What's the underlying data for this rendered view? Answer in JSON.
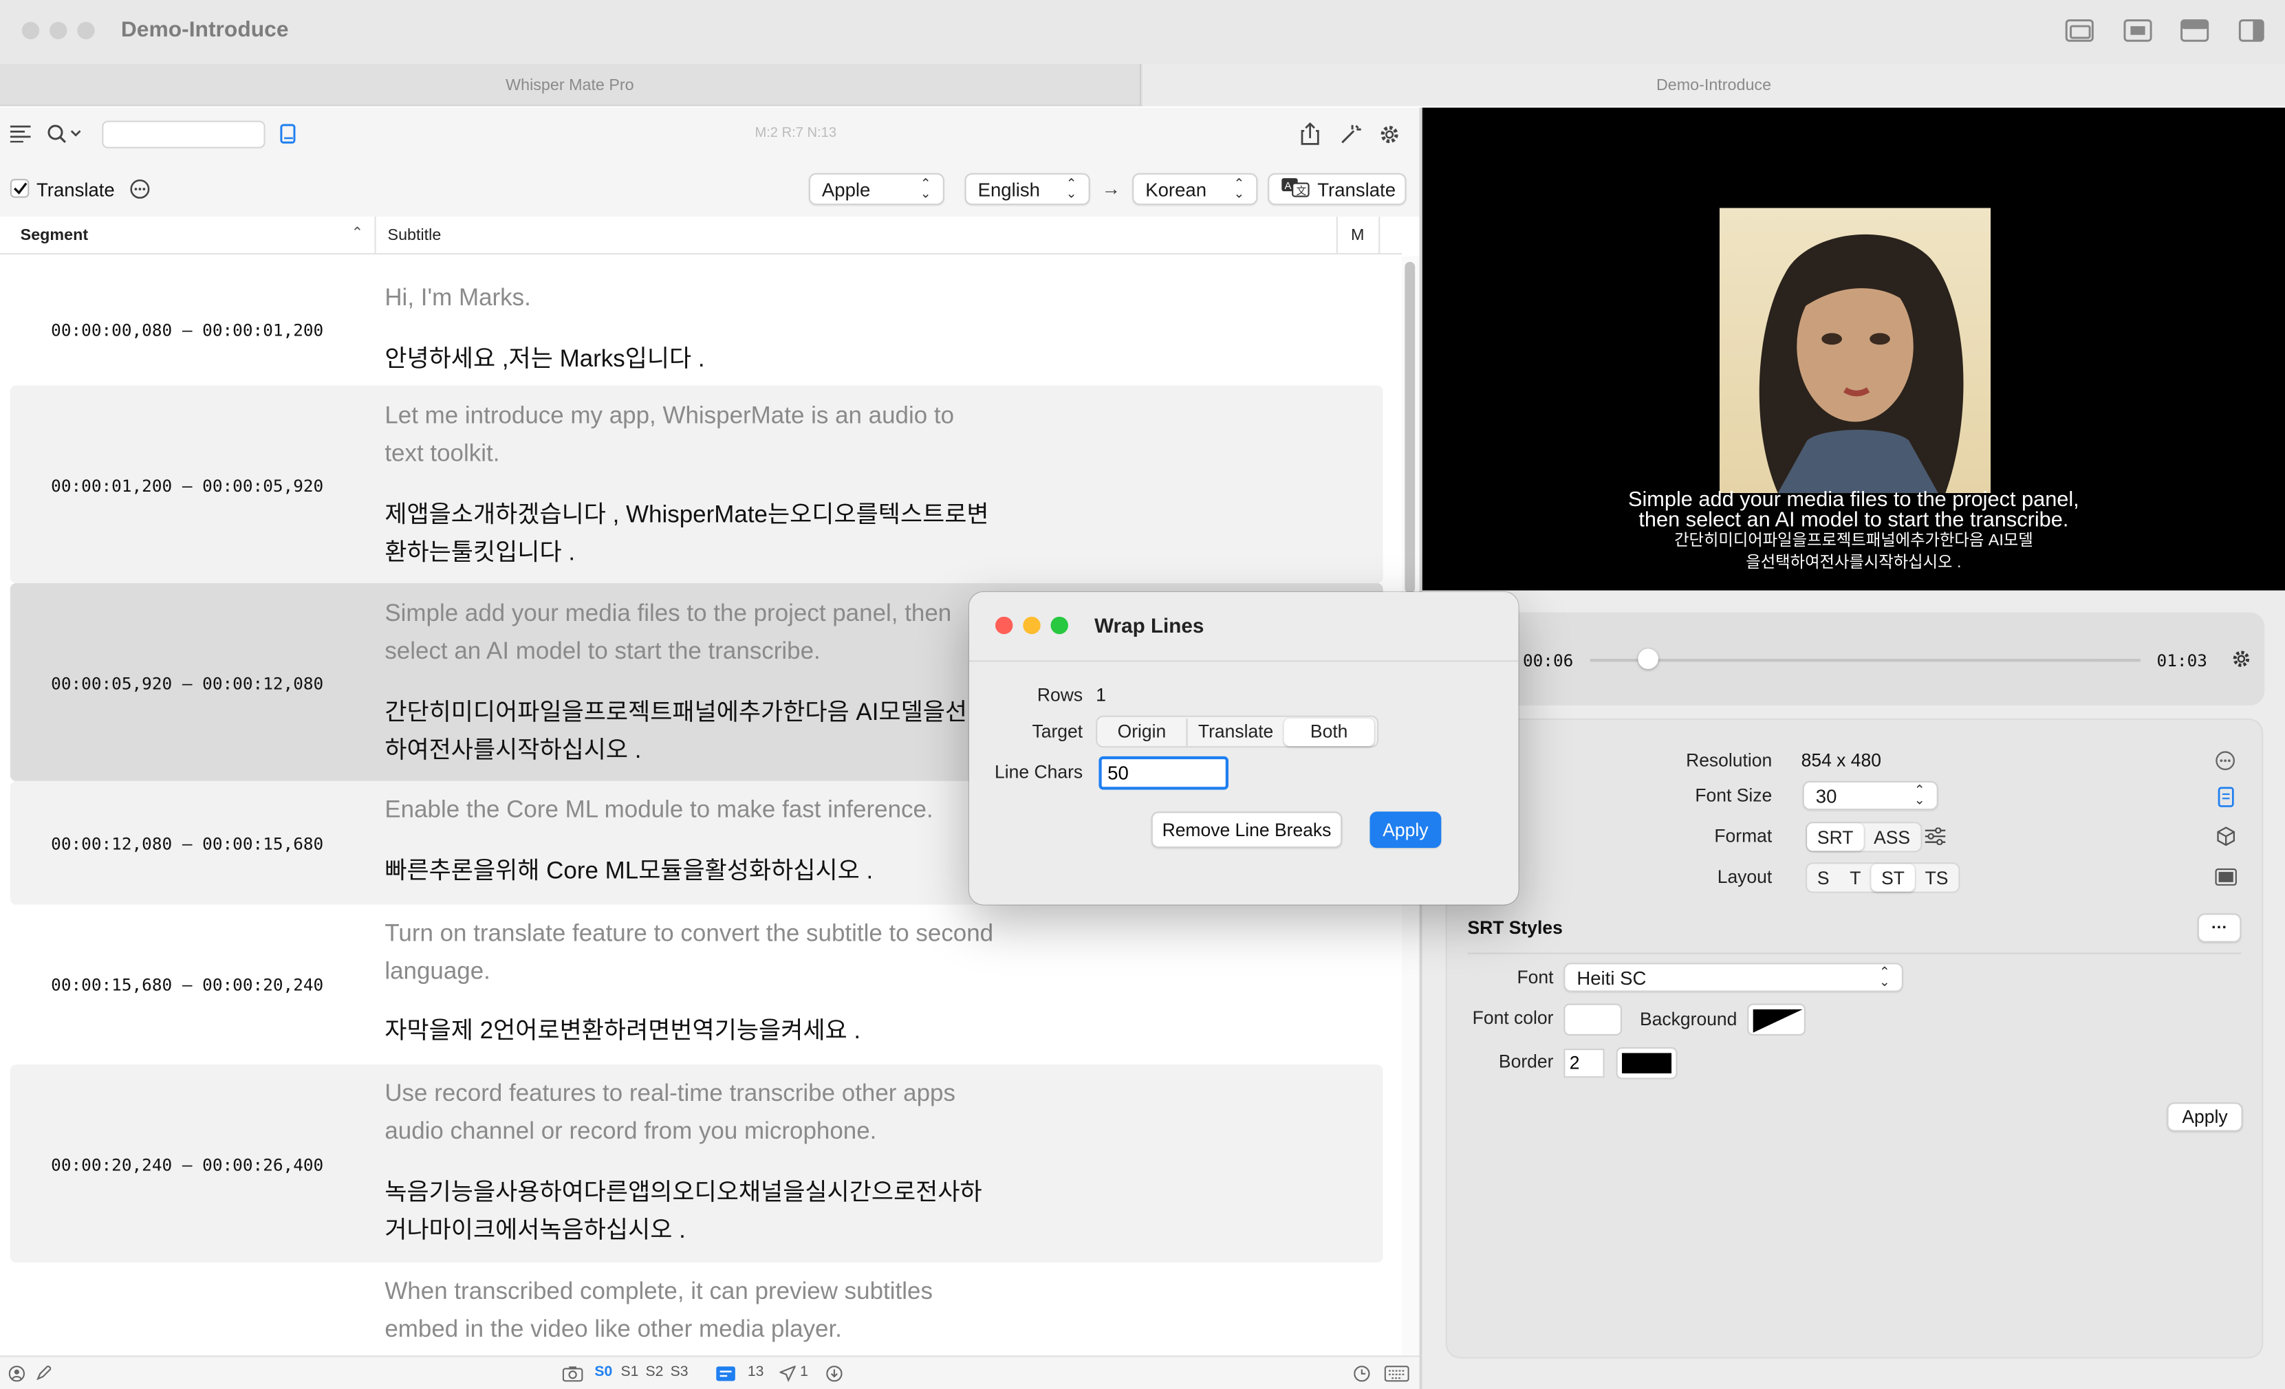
{
  "window": {
    "title": "Demo-Introduce"
  },
  "tabs": [
    "Whisper Mate Pro",
    "Demo-Introduce"
  ],
  "toolbar": {
    "search_value": "",
    "stats": "M:2 R:7 N:13"
  },
  "translate_bar": {
    "checkbox_label": "Translate",
    "checked": true,
    "engine": "Apple",
    "source_lang": "English",
    "arrow": "→",
    "target_lang": "Korean",
    "translate_button": "Translate"
  },
  "table": {
    "col_segment": "Segment",
    "col_subtitle": "Subtitle",
    "col_m": "M",
    "rows": [
      {
        "time": "00:00:00,080 – 00:00:01,200",
        "origin": "Hi, I'm Marks.",
        "translation": "안녕하세요 ,저는 Marks입니다 ."
      },
      {
        "time": "00:00:01,200 – 00:00:05,920",
        "origin": "Let me introduce my app, WhisperMate is an audio to text toolkit.",
        "translation": "제앱을소개하겠습니다 , WhisperMate는오디오를텍스트로변환하는툴킷입니다 ."
      },
      {
        "time": "00:00:05,920 – 00:00:12,080",
        "origin": "Simple add your media files to the project panel, then select an AI model to start the transcribe.",
        "translation": "간단히미디어파일을프로젝트패널에추가한다음 AI모델을선택하여전사를시작하십시오 ."
      },
      {
        "time": "00:00:12,080 – 00:00:15,680",
        "origin": "Enable the Core ML module to make fast inference.",
        "translation": "빠른추론을위해 Core ML모듈을활성화하십시오 ."
      },
      {
        "time": "00:00:15,680 – 00:00:20,240",
        "origin": "Turn on translate feature to convert the subtitle to second language.",
        "translation": "자막을제 2언어로변환하려면번역기능을켜세요 ."
      },
      {
        "time": "00:00:20,240 – 00:00:26,400",
        "origin": "Use record features to real-time transcribe other apps audio channel or record from you microphone.",
        "translation": "녹음기능을사용하여다른앱의오디오채널을실시간으로전사하거나마이크에서녹음하십시오 ."
      },
      {
        "time": "",
        "origin": "When transcribed complete, it can preview subtitles embed in the video like other media player.",
        "translation": ""
      }
    ]
  },
  "statusbar": {
    "s0": "S0",
    "s1": "S1",
    "s2": "S2",
    "s3": "S3",
    "count": "13",
    "sent": "1"
  },
  "video": {
    "subtitle_en_1": "Simple add your media files to the project panel,",
    "subtitle_en_2": "then select an AI model to start the transcribe.",
    "subtitle_ko_1": "간단히미디어파일을프로젝트패널에추가한다음 AI모델",
    "subtitle_ko_2": "을선택하여전사를시작하십시오 ."
  },
  "player": {
    "current": "00:06",
    "duration": "01:03",
    "progress": 0.07
  },
  "settings": {
    "resolution_label": "Resolution",
    "resolution_value": "854 x 480",
    "font_size_label": "Font Size",
    "font_size_value": "30",
    "format_label": "Format",
    "format_options": [
      "SRT",
      "ASS"
    ],
    "format_selected": "SRT",
    "layout_label": "Layout",
    "layout_options": [
      "S",
      "T",
      "ST",
      "TS"
    ],
    "layout_selected": "ST"
  },
  "srt_styles": {
    "title": "SRT Styles",
    "more": "···",
    "font_label": "Font",
    "font_value": "Heiti SC",
    "font_color_label": "Font color",
    "font_color": "#ffffff",
    "background_label": "Background",
    "border_label": "Border",
    "border_value": "2",
    "border_color": "#000000",
    "apply": "Apply"
  },
  "dialog": {
    "title": "Wrap Lines",
    "rows_label": "Rows",
    "rows_value": "1",
    "target_label": "Target",
    "target_options": [
      "Origin",
      "Translate",
      "Both"
    ],
    "target_selected": "Both",
    "line_chars_label": "Line Chars",
    "line_chars_value": "50",
    "remove_button": "Remove Line Breaks",
    "apply_button": "Apply"
  },
  "colors": {
    "accent": "#1f7ff0",
    "close": "#ff5f57",
    "minimize": "#febc2e",
    "zoom": "#28c840",
    "selected_row": "#dcdcdc"
  }
}
